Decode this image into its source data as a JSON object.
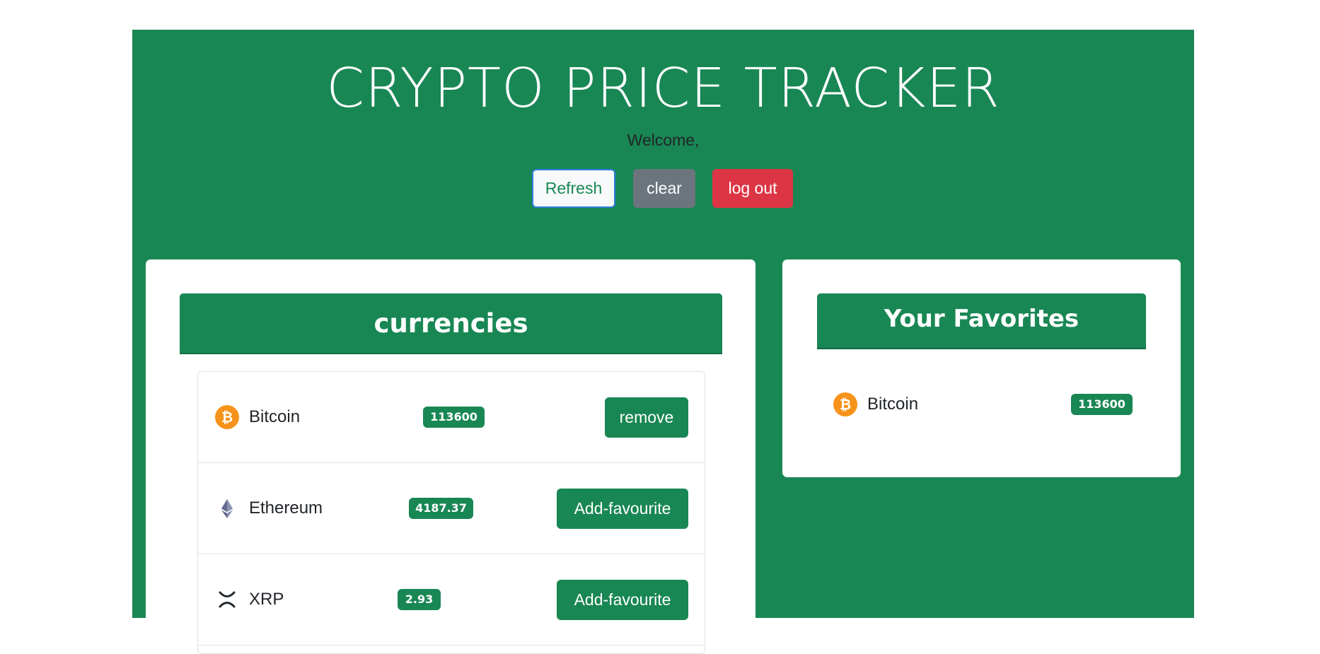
{
  "header": {
    "title": "CRYPTO PRICE TRACKER",
    "welcome": "Welcome,"
  },
  "actions": {
    "refresh_label": "Refresh",
    "clear_label": "clear",
    "logout_label": "log out"
  },
  "currencies": {
    "title": "currencies",
    "items": [
      {
        "name": "Bitcoin",
        "price": "113600",
        "icon": "bitcoin-icon",
        "action_label": "remove"
      },
      {
        "name": "Ethereum",
        "price": "4187.37",
        "icon": "ethereum-icon",
        "action_label": "Add-favourite"
      },
      {
        "name": "XRP",
        "price": "2.93",
        "icon": "xrp-icon",
        "action_label": "Add-favourite"
      }
    ]
  },
  "favorites": {
    "title": "Your Favorites",
    "items": [
      {
        "name": "Bitcoin",
        "price": "113600",
        "icon": "bitcoin-icon"
      }
    ]
  },
  "colors": {
    "primary_green": "#198754",
    "danger_red": "#dc3545",
    "secondary_gray": "#6c757d",
    "bitcoin_orange": "#f7931a"
  }
}
